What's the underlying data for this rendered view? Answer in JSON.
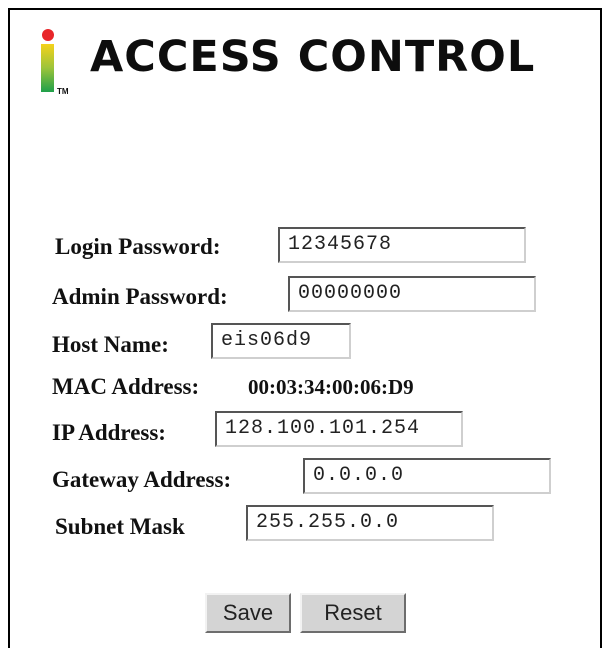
{
  "header": {
    "title": "ACCESS CONTROL",
    "logo_mark": "TM"
  },
  "form": {
    "login_password": {
      "label": "Login Password:",
      "value": "12345678"
    },
    "admin_password": {
      "label": "Admin Password:",
      "value": "00000000"
    },
    "host_name": {
      "label": "Host Name:",
      "value": "eis06d9"
    },
    "mac_address": {
      "label": "MAC Address:",
      "value": "00:03:34:00:06:D9"
    },
    "ip_address": {
      "label": "IP Address:",
      "value": "128.100.101.254"
    },
    "gateway_address": {
      "label": "Gateway Address:",
      "value": "0.0.0.0"
    },
    "subnet_mask": {
      "label": "Subnet Mask",
      "value": "255.255.0.0"
    }
  },
  "buttons": {
    "save": "Save",
    "reset": "Reset"
  },
  "colors": {
    "logo_dot": "#e8262a",
    "logo_bar_top": "#f5d21a",
    "logo_bar_bottom": "#1fa04a",
    "button_face": "#d4d4d4"
  }
}
